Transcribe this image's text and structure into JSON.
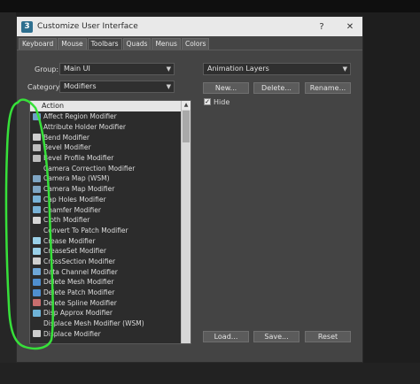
{
  "window": {
    "title": "Customize User Interface",
    "help": "?",
    "close": "✕"
  },
  "tabs": [
    {
      "label": "Keyboard"
    },
    {
      "label": "Mouse"
    },
    {
      "label": "Toolbars",
      "active": true
    },
    {
      "label": "Quads"
    },
    {
      "label": "Menus"
    },
    {
      "label": "Colors"
    }
  ],
  "group": {
    "label": "Group:",
    "value": "Main UI"
  },
  "category": {
    "label": "Category:",
    "value": "Modifiers"
  },
  "toolbar_select": {
    "value": "Animation Layers"
  },
  "buttons": {
    "new": "New...",
    "delete": "Delete...",
    "rename": "Rename...",
    "load": "Load...",
    "save": "Save...",
    "reset": "Reset"
  },
  "hide": {
    "label": "Hide",
    "checked": true
  },
  "list": {
    "header": "Action",
    "items": [
      {
        "label": "Affect Region Modifier",
        "icon": "affect-region-icon",
        "color": "#6da0c8"
      },
      {
        "label": "Attribute Holder Modifier",
        "icon": "none",
        "color": ""
      },
      {
        "label": "Bend Modifier",
        "icon": "bend-icon",
        "color": "#cfcfcf"
      },
      {
        "label": "Bevel Modifier",
        "icon": "bevel-icon",
        "color": "#bdbdbd"
      },
      {
        "label": "Bevel Profile Modifier",
        "icon": "bevel-profile-icon",
        "color": "#bdbdbd"
      },
      {
        "label": "Camera Correction Modifier",
        "icon": "none",
        "color": ""
      },
      {
        "label": "Camera Map (WSM)",
        "icon": "camera-map-wsm-icon",
        "color": "#7fa6c4"
      },
      {
        "label": "Camera Map Modifier",
        "icon": "camera-map-icon",
        "color": "#7fa6c4"
      },
      {
        "label": "Cap Holes Modifier",
        "icon": "cap-holes-icon",
        "color": "#79b2d6"
      },
      {
        "label": "Chamfer Modifier",
        "icon": "chamfer-icon",
        "color": "#79b2d6"
      },
      {
        "label": "Cloth Modifier",
        "icon": "cloth-icon",
        "color": "#d6d6d6"
      },
      {
        "label": "Convert To Patch Modifier",
        "icon": "none",
        "color": ""
      },
      {
        "label": "Crease Modifier",
        "icon": "crease-icon",
        "color": "#9ad0e8"
      },
      {
        "label": "CreaseSet Modifier",
        "icon": "creaseset-icon",
        "color": "#9ad0e8"
      },
      {
        "label": "CrossSection Modifier",
        "icon": "crosssection-icon",
        "color": "#cfcfcf"
      },
      {
        "label": "Data Channel Modifier",
        "icon": "data-channel-icon",
        "color": "#6ea7d8"
      },
      {
        "label": "Delete Mesh Modifier",
        "icon": "delete-mesh-icon",
        "color": "#4f8fd0"
      },
      {
        "label": "Delete Patch Modifier",
        "icon": "delete-patch-icon",
        "color": "#4f8fd0"
      },
      {
        "label": "Delete Spline Modifier",
        "icon": "delete-spline-icon",
        "color": "#c86e6e"
      },
      {
        "label": "Disp Approx Modifier",
        "icon": "disp-approx-icon",
        "color": "#6fb3d8"
      },
      {
        "label": "Displace Mesh Modifier (WSM)",
        "icon": "none",
        "color": ""
      },
      {
        "label": "Displace Modifier",
        "icon": "displace-icon",
        "color": "#cfcfcf"
      }
    ]
  },
  "colors": {
    "annotation": "#37e03a",
    "window_bg": "#444444",
    "list_bg": "#2c2c2c"
  }
}
